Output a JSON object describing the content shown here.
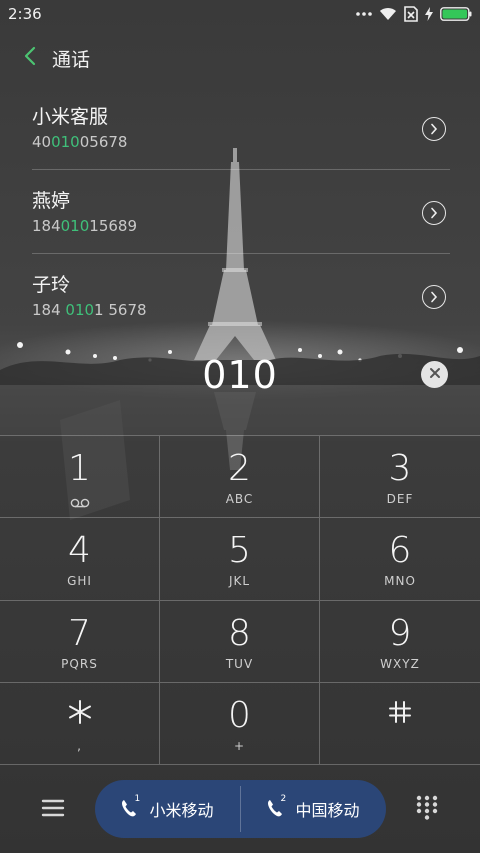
{
  "status_bar": {
    "time": "2:36",
    "icons": [
      "more-dots-icon",
      "wifi-icon",
      "no-sim-icon",
      "charging-bolt-icon",
      "battery-icon"
    ],
    "battery_color": "#34c759"
  },
  "header": {
    "title": "通话",
    "back_icon": "chevron-left-icon",
    "accent": "#4cc472"
  },
  "suggestions": [
    {
      "name": "小米客服",
      "number_pre": "40",
      "number_match": "010",
      "number_post": "05678"
    },
    {
      "name": "燕婷",
      "number_pre": "184",
      "number_match": "010",
      "number_post": "15689"
    },
    {
      "name": "子玲",
      "number_pre": "184 ",
      "number_match": "010",
      "number_post": "1 5678"
    }
  ],
  "match_color": "#3fc07a",
  "dialer": {
    "input_value": "010",
    "clear_icon": "backspace-clear-icon"
  },
  "keypad": [
    {
      "digit": "1",
      "letters": "",
      "sub_icon": "voicemail-icon"
    },
    {
      "digit": "2",
      "letters": "ABC"
    },
    {
      "digit": "3",
      "letters": "DEF"
    },
    {
      "digit": "4",
      "letters": "GHI"
    },
    {
      "digit": "5",
      "letters": "JKL"
    },
    {
      "digit": "6",
      "letters": "MNO"
    },
    {
      "digit": "7",
      "letters": "PQRS"
    },
    {
      "digit": "8",
      "letters": "TUV"
    },
    {
      "digit": "9",
      "letters": "WXYZ"
    },
    {
      "symbol_icon": "asterisk-icon",
      "letters": ","
    },
    {
      "digit": "0",
      "letters": "+"
    },
    {
      "symbol_icon": "hash-icon",
      "letters": ""
    }
  ],
  "bottom_bar": {
    "menu_icon": "menu-lines-icon",
    "sim1": {
      "label": "小米移动",
      "slot": "1",
      "icon": "phone-icon"
    },
    "sim2": {
      "label": "中国移动",
      "slot": "2",
      "icon": "phone-icon"
    },
    "pill_color": "#2b4677",
    "keypad_icon": "dialpad-grid-icon"
  }
}
